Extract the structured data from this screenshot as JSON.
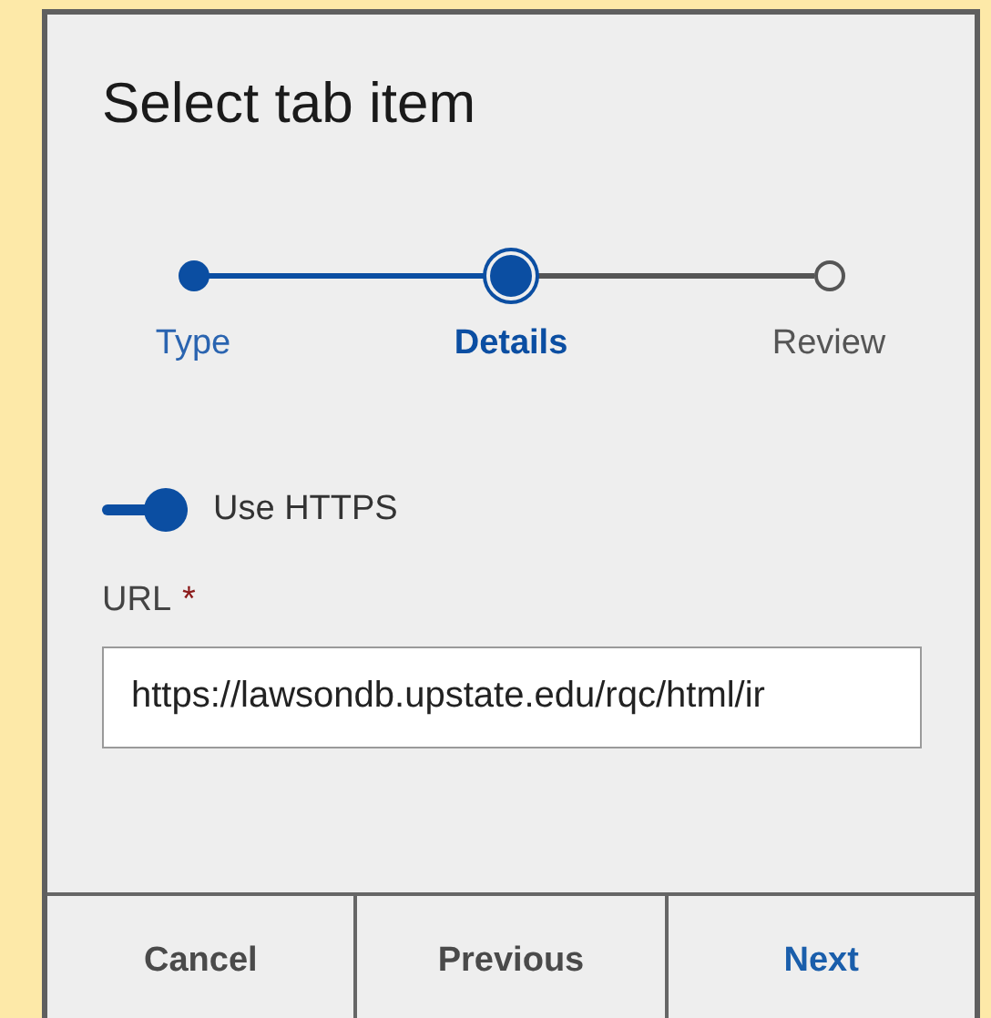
{
  "dialog": {
    "title": "Select tab item"
  },
  "steps": [
    {
      "label": "Type",
      "completed": true,
      "selected": false
    },
    {
      "label": "Details",
      "completed": false,
      "selected": true
    },
    {
      "label": "Review",
      "completed": false,
      "selected": false
    }
  ],
  "toggle": {
    "label": "Use HTTPS",
    "on": true
  },
  "url_field": {
    "label": "URL",
    "required_mark": "*",
    "value": "https://lawsondb.upstate.edu/rqc/html/ir"
  },
  "buttons": [
    {
      "label": "Cancel",
      "kind": "secondary"
    },
    {
      "label": "Previous",
      "kind": "secondary"
    },
    {
      "label": "Next",
      "kind": "primary"
    }
  ]
}
